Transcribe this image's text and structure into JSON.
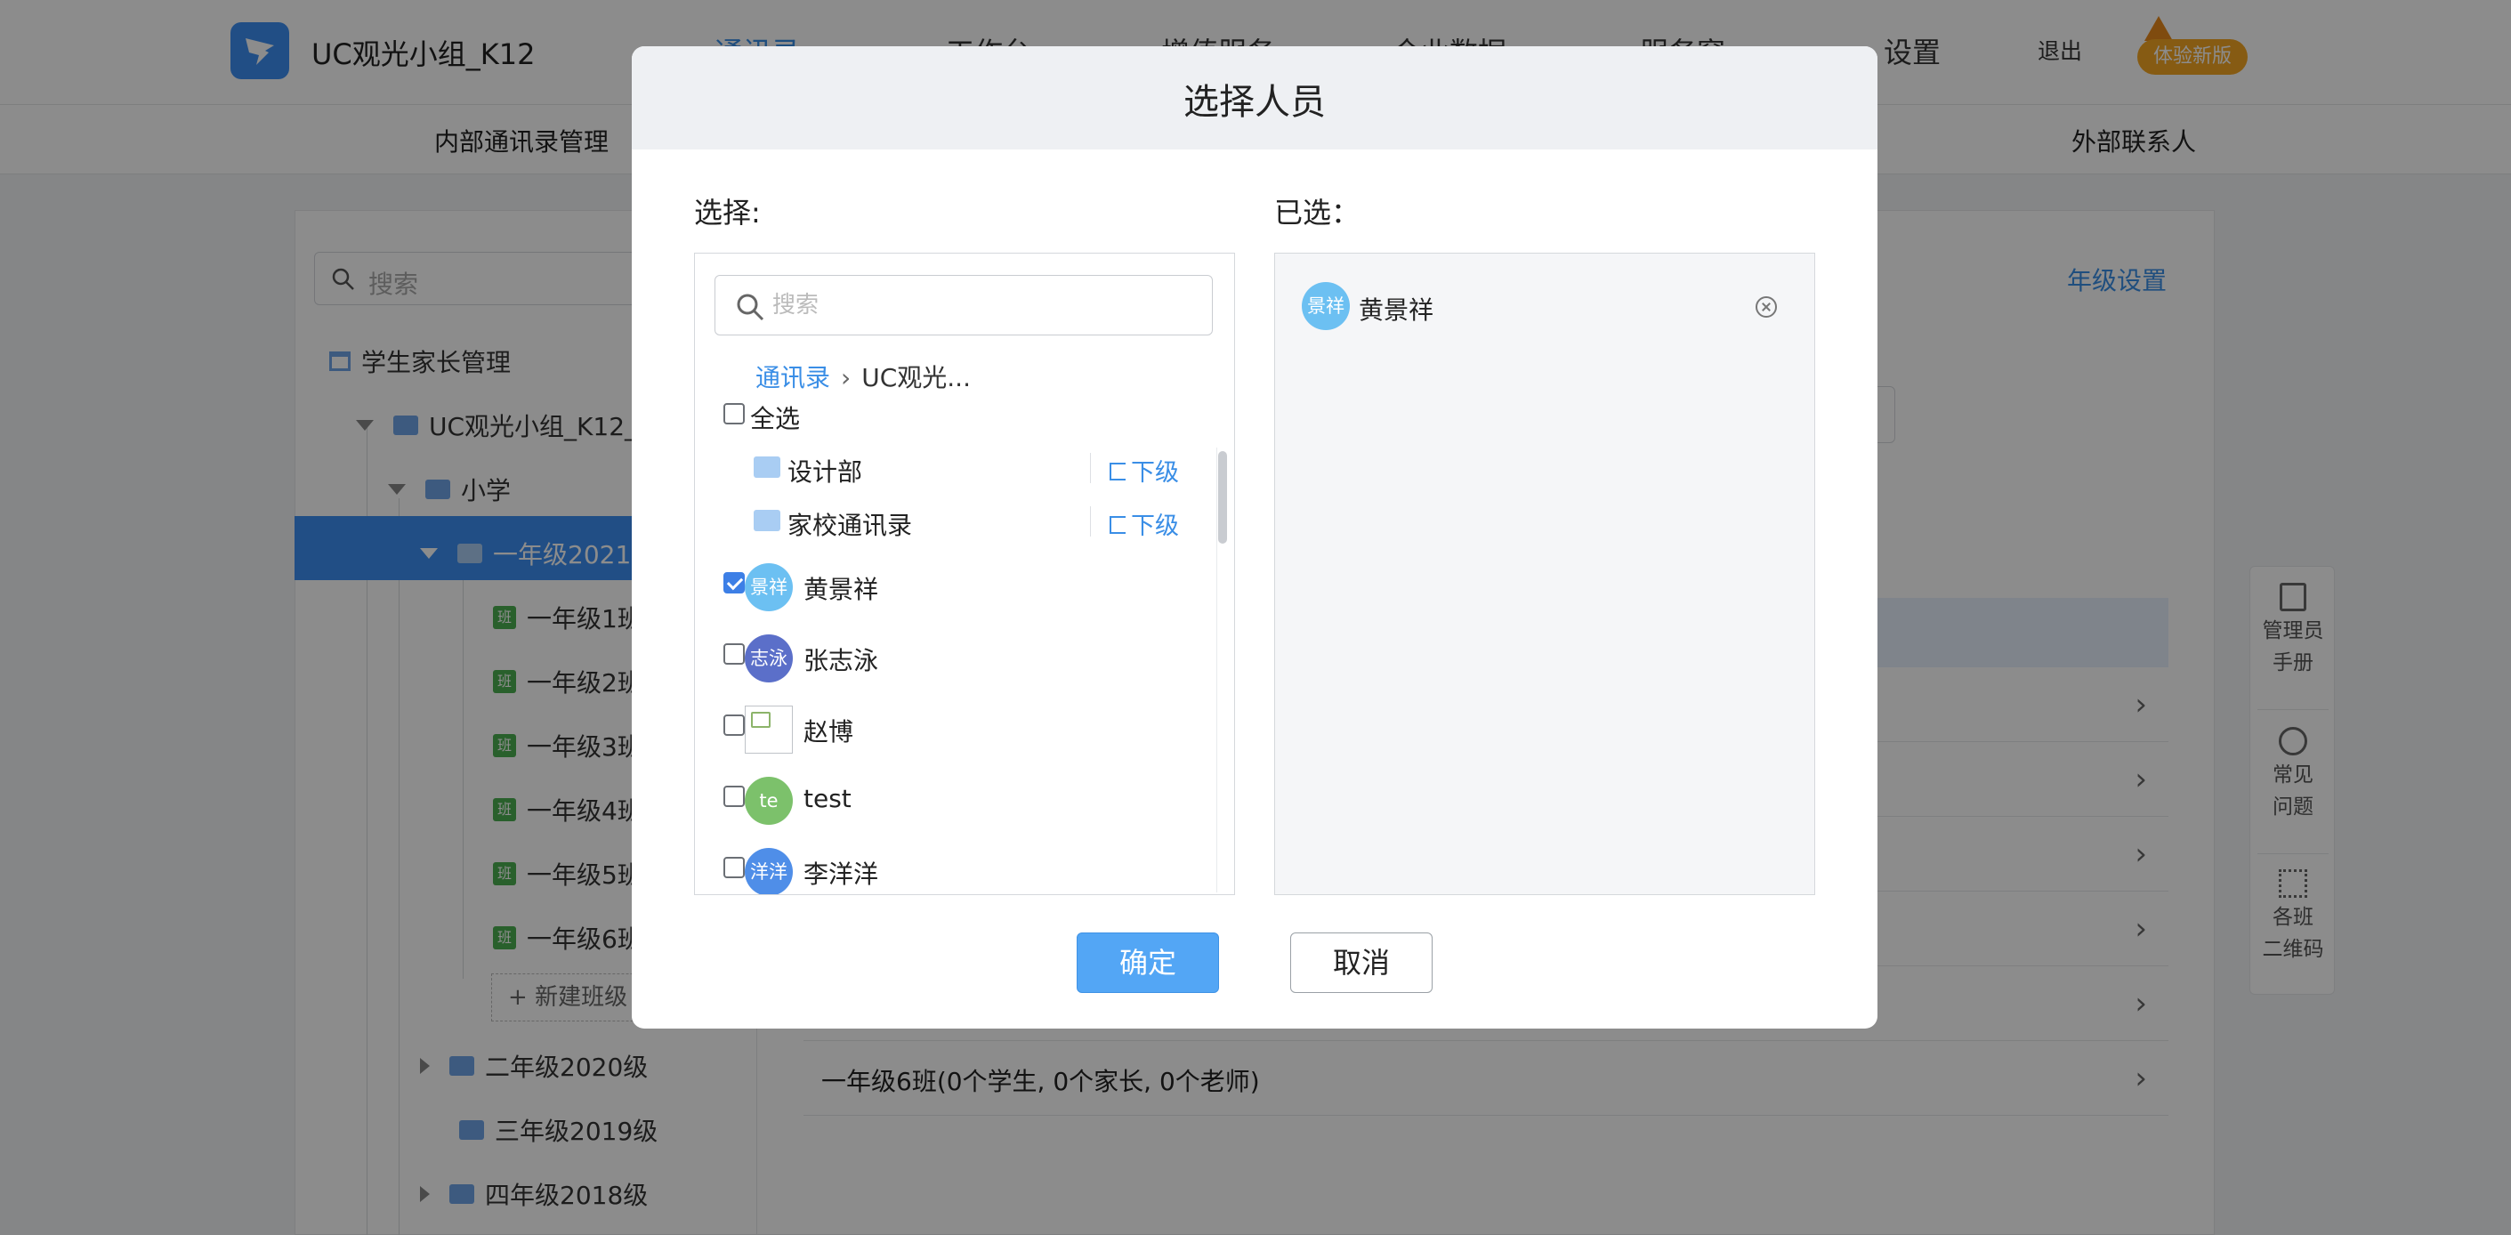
{
  "app": {
    "title": "UC观光小组_K12",
    "logout": "退出",
    "new_version": "体验新版"
  },
  "top_nav": [
    {
      "label": "通讯录",
      "active": true
    },
    {
      "label": "工作台",
      "active": false
    },
    {
      "label": "增值服务",
      "active": false
    },
    {
      "label": "企业数据",
      "active": false
    },
    {
      "label": "服务窗",
      "active": false
    },
    {
      "label": "设置",
      "active": false
    }
  ],
  "sub_nav": {
    "left": "内部通讯录管理",
    "right": "外部联系人"
  },
  "sidebar": {
    "search_placeholder": "搜索",
    "root": "学生家长管理",
    "org": "UC观光小组_K12_",
    "school": "小学",
    "grade_selected": "一年级2021",
    "classes": [
      "一年级1班",
      "一年级2班",
      "一年级3班",
      "一年级4班",
      "一年级5班",
      "一年级6班"
    ],
    "class_badge": "班",
    "new_class": "新建班级",
    "other_grades": [
      "二年级2020级",
      "三年级2019级",
      "四年级2018级"
    ]
  },
  "main": {
    "grade_settings": "年级设置",
    "visible_row": "一年级6班(0个学生, 0个家长, 0个老师)"
  },
  "helper": {
    "manual": [
      "管理员",
      "手册"
    ],
    "faq": [
      "常见",
      "问题"
    ],
    "qrcode": [
      "各班",
      "二维码"
    ]
  },
  "modal": {
    "title": "选择人员",
    "select_label": "选择:",
    "selected_label": "已选：",
    "search_placeholder": "搜索",
    "breadcrumb": {
      "root": "通讯录",
      "current": "UC观光..."
    },
    "select_all": "全选",
    "sub_level": "下级",
    "departments": [
      "设计部",
      "家校通讯录"
    ],
    "people": [
      {
        "name": "黄景祥",
        "avatar_text": "景祥",
        "color": "#6cc0f2",
        "checked": true
      },
      {
        "name": "张志泳",
        "avatar_text": "志泳",
        "color": "#5b6fc9",
        "checked": false
      },
      {
        "name": "赵博",
        "avatar_text": "",
        "color": "",
        "checked": false
      },
      {
        "name": "test",
        "avatar_text": "te",
        "color": "#7cc16b",
        "checked": false
      },
      {
        "name": "李洋洋",
        "avatar_text": "洋洋",
        "color": "#4f8ee8",
        "checked": false
      }
    ],
    "selected": [
      {
        "name": "黄景祥",
        "avatar_text": "景祥",
        "color": "#6cc0f2"
      }
    ],
    "confirm": "确定",
    "cancel": "取消"
  }
}
